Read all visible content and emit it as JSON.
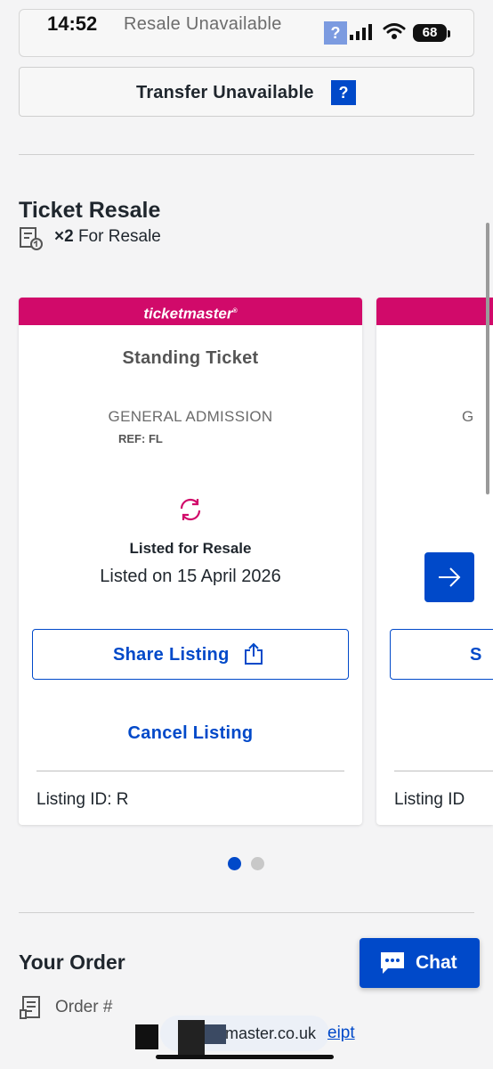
{
  "status_bar": {
    "time": "14:52",
    "battery": "68"
  },
  "header": {
    "resale_unavailable": "Resale Unavailable",
    "help_glyph": "?",
    "transfer_unavailable": "Transfer Unavailable"
  },
  "ticket_resale": {
    "title": "Ticket Resale",
    "count": "×2",
    "for_resale": "For Resale",
    "icon": "ticket-resale-icon"
  },
  "cards": [
    {
      "brand": "ticketmaster",
      "brand_mark": "®",
      "ticket_type": "Standing Ticket",
      "section": "GENERAL ADMISSION",
      "ref": "REF: FL",
      "status": "Listed for Resale",
      "listed_date": "Listed on 15 April 2026",
      "share_label": "Share Listing",
      "cancel_label": "Cancel Listing",
      "listing_id": "Listing ID: R"
    },
    {
      "section_partial": "G",
      "share_partial": "S",
      "listing_id_partial": "Listing ID"
    }
  ],
  "pagination": {
    "pages": 2,
    "active": 1
  },
  "order": {
    "title": "Your Order",
    "order_number_label": "Order #",
    "domain_text": "master.co.uk",
    "receipt_text": "eipt"
  },
  "chat": {
    "label": "Chat"
  },
  "colors": {
    "brand_pink": "#d10a6a",
    "primary_blue": "#0049c9",
    "background": "#f4f4f5"
  }
}
